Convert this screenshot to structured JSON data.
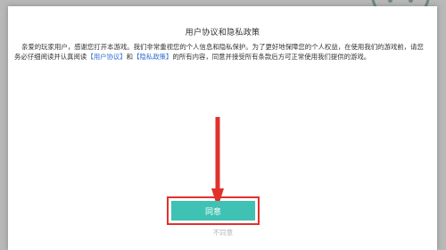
{
  "dialog": {
    "title": "用户协议和隐私政策",
    "body_part1": "亲爱的玩家用户，感谢您打开本游戏。我们非常重视您的个人信息和隐私保护。为了更好地保障您的个人权益，在使用我们的游戏前，请您务必仔细阅读并认真阅读",
    "link_user_agreement": "【用户协议】",
    "body_and": "和",
    "link_privacy_policy": "【隐私政策】",
    "body_part2": "的所有内容，同意并接受所有条款后方可正常使用我们提供的游戏。",
    "agree_label": "同意",
    "disagree_label": "不同意"
  },
  "colors": {
    "accent_teal": "#3fc2b3",
    "highlight_red": "#e0322b",
    "link_blue": "#2f6fd1"
  },
  "icons": {
    "pointer_arrow": "arrow-down-icon"
  }
}
